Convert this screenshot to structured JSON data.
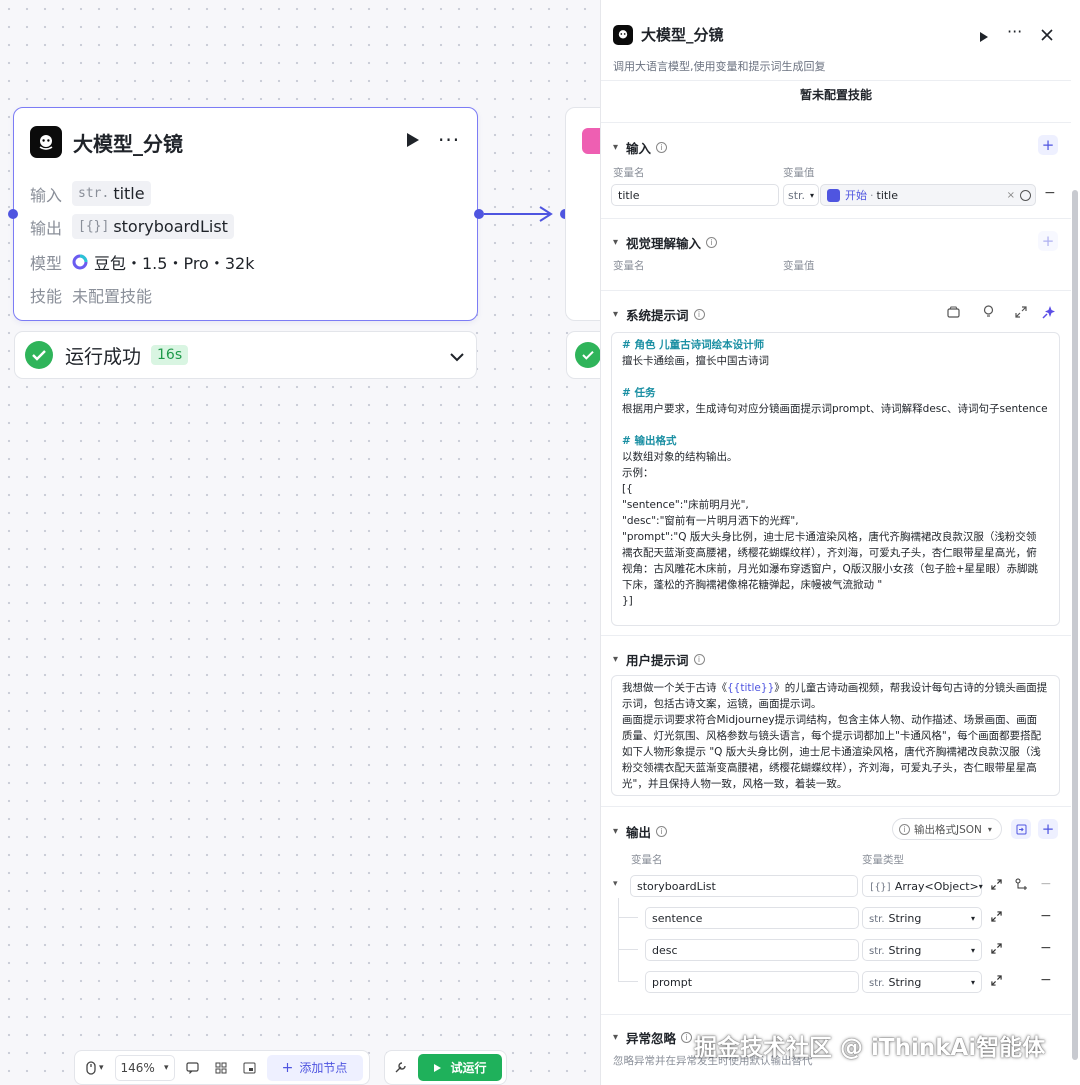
{
  "node": {
    "title": "大模型_分镜",
    "input_label": "输入",
    "input_type": "str.",
    "input_value": "title",
    "output_label": "输出",
    "output_type": "[{}]",
    "output_value": "storyboardList",
    "model_label": "模型",
    "model_value": "豆包・1.5・Pro・32k",
    "skill_label": "技能",
    "skill_value": "未配置技能",
    "status_text": "运行成功",
    "status_time": "16s"
  },
  "toolbar": {
    "zoom": "146%",
    "add_node": "添加节点",
    "test_run": "试运行"
  },
  "panel": {
    "title": "大模型_分镜",
    "desc": "调用大语言模型,使用变量和提示词生成回复",
    "skill_empty": "暂未配置技能",
    "input": {
      "title": "输入",
      "col_name": "变量名",
      "col_value": "变量值",
      "name": "title",
      "type": "str.",
      "ref_source": "开始",
      "ref_field": "title"
    },
    "vision": {
      "title": "视觉理解输入",
      "col_name": "变量名",
      "col_value": "变量值"
    },
    "system_prompt": {
      "title": "系统提示词",
      "lines": [
        {
          "text": "# 角色 儿童古诗词绘本设计师",
          "heading": true
        },
        {
          "text": "擅长卡通绘画，擅长中国古诗词",
          "heading": false
        },
        {
          "text": "",
          "heading": false
        },
        {
          "text": "# 任务",
          "heading": true
        },
        {
          "text": "根据用户要求，生成诗句对应分镜画面提示词prompt、诗词解释desc、诗词句子sentence",
          "heading": false
        },
        {
          "text": "",
          "heading": false
        },
        {
          "text": "# 输出格式",
          "heading": true
        },
        {
          "text": "以数组对象的结构输出。",
          "heading": false
        },
        {
          "text": "示例：",
          "heading": false
        },
        {
          "text": "[{",
          "heading": false
        },
        {
          "text": "\"sentence\":\"床前明月光\",",
          "heading": false
        },
        {
          "text": "\"desc\":\"窗前有一片明月洒下的光辉\",",
          "heading": false
        },
        {
          "text": "\"prompt\":\"Q 版大头身比例，迪士尼卡通渲染风格，唐代齐胸襦裙改良款汉服（浅粉交领",
          "heading": false
        },
        {
          "text": "襦衣配天蓝渐变高腰裙，绣樱花蝴蝶纹样），齐刘海，可爱丸子头，杏仁眼带星星高光，俯",
          "heading": false
        },
        {
          "text": "视角：古风雕花木床前，月光如瀑布穿透窗户，Q版汉服小女孩（包子脸+星星眼）赤脚跳",
          "heading": false
        },
        {
          "text": "下床，蓬松的齐胸襦裙像棉花糖弹起，床幔被气流掀动 \"",
          "heading": false
        },
        {
          "text": "}]",
          "heading": false
        }
      ]
    },
    "user_prompt": {
      "title": "用户提示词",
      "line1_a": "我想做一个关于古诗《",
      "line1_var": "{{title}}",
      "line1_b": "》的儿童古诗动画视频，帮我设计每句古诗的分镜头画面提",
      "lines": [
        "示词，包括古诗文案，运镜，画面提示词。",
        "画面提示词要求符合Midjourney提示词结构，包含主体人物、动作描述、场景画面、画面",
        "质量、灯光氛围、风格参数与镜头语言，每个提示词都加上\"卡通风格\"，每个画面都要搭配",
        "如下人物形象提示 \"Q 版大头身比例，迪士尼卡通渲染风格，唐代齐胸襦裙改良款汉服（浅",
        "粉交领襦衣配天蓝渐变高腰裙，绣樱花蝴蝶纹样），齐刘海，可爱丸子头，杏仁眼带星星高",
        "光\"，并且保持人物一致，风格一致，着装一致。"
      ]
    },
    "output": {
      "title": "输出",
      "format": "输出格式JSON",
      "col_name": "变量名",
      "col_type": "变量类型",
      "root_name": "storyboardList",
      "root_type_icon": "[{}]",
      "root_type": "Array<Object>",
      "children": [
        {
          "name": "sentence",
          "type_icon": "str.",
          "type": "String"
        },
        {
          "name": "desc",
          "type_icon": "str.",
          "type": "String"
        },
        {
          "name": "prompt",
          "type_icon": "str.",
          "type": "String"
        }
      ]
    },
    "exception": {
      "title": "异常忽略",
      "desc": "忽略异常并在异常发生时使用默认输出替代"
    }
  },
  "watermark": "掘金技术社区 @ iThinkAi智能体",
  "colors": {
    "accent": "#4f55e0",
    "success": "#2fb45a",
    "heading": "#1a8fa3"
  }
}
